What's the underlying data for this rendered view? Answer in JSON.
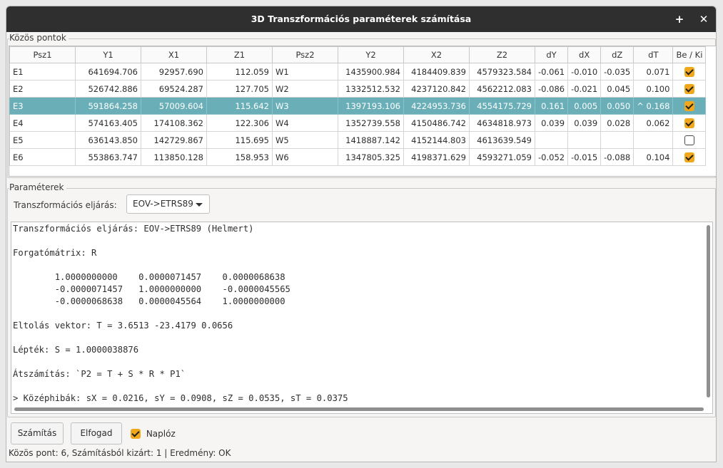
{
  "window": {
    "title": "3D Transzformációs paraméterek számítása",
    "max_glyph": "+",
    "close_glyph": "✕"
  },
  "points_group": {
    "title": "Közös pontok",
    "columns": [
      "Psz1",
      "Y1",
      "X1",
      "Z1",
      "Psz2",
      "Y2",
      "X2",
      "Z2",
      "dY",
      "dX",
      "dZ",
      "dT",
      "Be / Ki"
    ],
    "rows": [
      {
        "psz1": "E1",
        "y1": "641694.706",
        "x1": "92957.690",
        "z1": "112.059",
        "psz2": "W1",
        "y2": "1435900.984",
        "x2": "4184409.839",
        "z2": "4579323.584",
        "dy": "-0.061",
        "dx": "-0.010",
        "dz": "-0.035",
        "dt": "0.071",
        "checked": true,
        "selected": false
      },
      {
        "psz1": "E2",
        "y1": "526742.886",
        "x1": "69524.287",
        "z1": "127.705",
        "psz2": "W2",
        "y2": "1332512.532",
        "x2": "4237120.842",
        "z2": "4562212.083",
        "dy": "-0.086",
        "dx": "-0.021",
        "dz": "0.045",
        "dt": "0.100",
        "checked": true,
        "selected": false
      },
      {
        "psz1": "E3",
        "y1": "591864.258",
        "x1": "57009.604",
        "z1": "115.642",
        "psz2": "W3",
        "y2": "1397193.106",
        "x2": "4224953.736",
        "z2": "4554175.729",
        "dy": "0.161",
        "dx": "0.005",
        "dz": "0.050",
        "dt": "^ 0.168",
        "checked": true,
        "selected": true
      },
      {
        "psz1": "E4",
        "y1": "574163.405",
        "x1": "174108.362",
        "z1": "122.306",
        "psz2": "W4",
        "y2": "1352739.558",
        "x2": "4150486.742",
        "z2": "4634818.973",
        "dy": "0.039",
        "dx": "0.039",
        "dz": "0.028",
        "dt": "0.062",
        "checked": true,
        "selected": false
      },
      {
        "psz1": "E5",
        "y1": "636143.850",
        "x1": "142729.867",
        "z1": "115.695",
        "psz2": "W5",
        "y2": "1418887.142",
        "x2": "4152144.803",
        "z2": "4613639.549",
        "dy": "",
        "dx": "",
        "dz": "",
        "dt": "",
        "checked": false,
        "selected": false
      },
      {
        "psz1": "E6",
        "y1": "553863.747",
        "x1": "113850.128",
        "z1": "158.953",
        "psz2": "W6",
        "y2": "1347805.325",
        "x2": "4198371.629",
        "z2": "4593271.059",
        "dy": "-0.052",
        "dx": "-0.015",
        "dz": "-0.088",
        "dt": "0.104",
        "checked": true,
        "selected": false
      }
    ]
  },
  "params_group": {
    "title": "Paraméterek",
    "method_label": "Transzformációs eljárás:",
    "method_value": "EOV->ETRS89",
    "log_lines": [
      "Transzformációs eljárás: EOV->ETRS89 (Helmert)",
      "",
      "Forgatómátrix: R",
      "",
      "        1.0000000000    0.0000071457    0.0000068638",
      "        -0.0000071457   1.0000000000    -0.0000045565",
      "        -0.0000068638   0.0000045564    1.0000000000",
      "",
      "Eltolás vektor: T = 3.6513 -23.4179 0.0656",
      "",
      "Lépték: S = 1.0000038876",
      "",
      "Átszámítás: `P2 = T + S * R * P1`",
      "",
      "> Középhibák: sX = 0.0216, sY = 0.0908, sZ = 0.0535, sT = 0.0375"
    ]
  },
  "buttons": {
    "compute": "Számítás",
    "accept": "Elfogad",
    "log_label": "Naplóz",
    "log_checked": true
  },
  "status": {
    "text": "Közös pont: 6, Számításból kizárt: 1  |  Eredmény: OK"
  },
  "colors": {
    "selected_row": "#6aafb8",
    "checkbox": "#f0a81a",
    "titlebar": "#2f2f2f"
  }
}
